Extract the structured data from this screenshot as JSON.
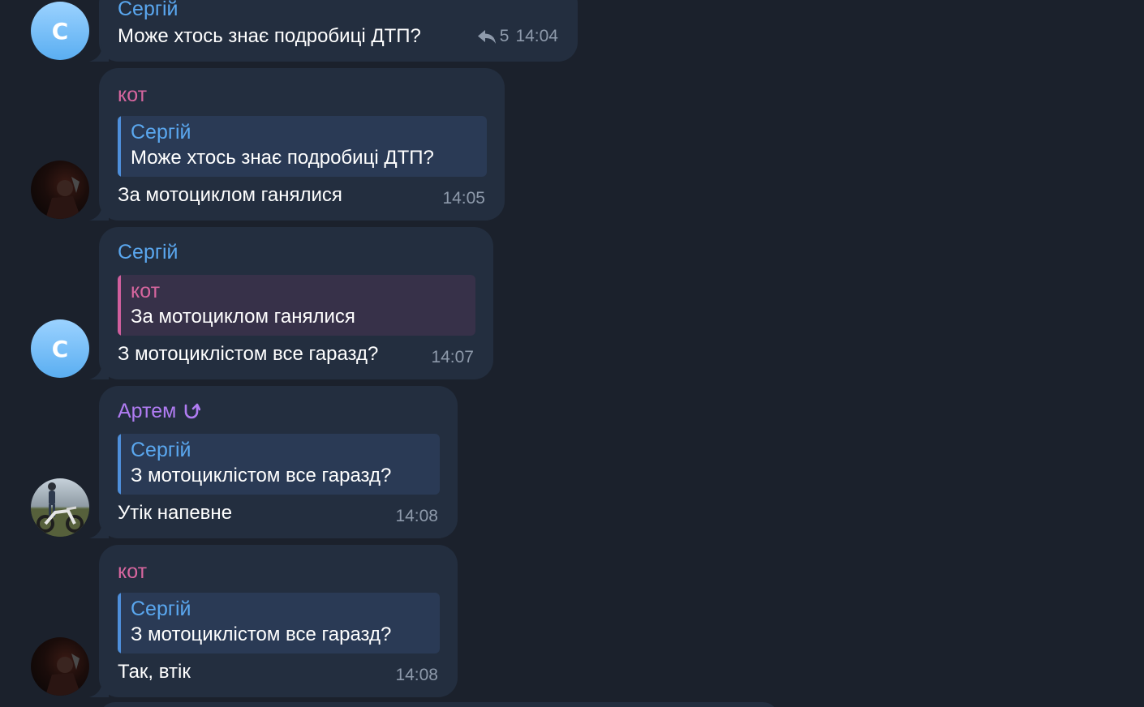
{
  "colors": {
    "background": "#1b212c",
    "bubble": "#232e3f",
    "sender_blue": "#5aa7ef",
    "sender_pink": "#d7669f",
    "sender_purple": "#b07cf2",
    "time_gray": "#8e9aab"
  },
  "messages": [
    {
      "sender": "Сергій",
      "avatar_letter": "С",
      "text": "Може хтось знає подробиці ДТП?",
      "reply_count": "5",
      "reply_icon": "reply-arrow-icon",
      "time": "14:04"
    },
    {
      "sender": "кот",
      "avatar_icon": "dark-photo-avatar",
      "quote": {
        "name": "Сергій",
        "text": "Може хтось знає подробиці ДТП?"
      },
      "text": "За мотоциклом ганялися",
      "time": "14:05"
    },
    {
      "sender": "Сергій",
      "avatar_letter": "С",
      "quote": {
        "name": "кот",
        "text": "За мотоциклом ганялися"
      },
      "text": "З мотоциклістом все гаразд?",
      "time": "14:07"
    },
    {
      "sender": "Артем",
      "sender_badge_icon": "refresh-badge-icon",
      "avatar_icon": "motorcycle-photo-avatar",
      "quote": {
        "name": "Сергій",
        "text": "З мотоциклістом все гаразд?"
      },
      "text": "Утік напевне",
      "time": "14:08"
    },
    {
      "sender": "кот",
      "avatar_icon": "dark-photo-avatar",
      "quote": {
        "name": "Сергій",
        "text": "З мотоциклістом все гаразд?"
      },
      "text": "Так, втік",
      "time": "14:08"
    }
  ]
}
